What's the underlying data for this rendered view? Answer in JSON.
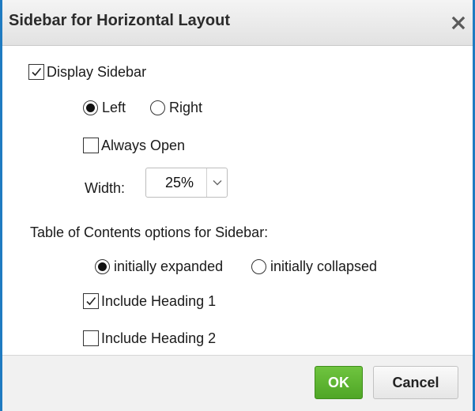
{
  "dialog": {
    "title": "Sidebar for Horizontal Layout",
    "close_icon": "close-icon"
  },
  "options": {
    "display_sidebar": {
      "label": "Display Sidebar",
      "checked": true
    },
    "position": {
      "left_label": "Left",
      "right_label": "Right",
      "selected": "Left"
    },
    "always_open": {
      "label": "Always Open",
      "checked": false
    },
    "width": {
      "label": "Width:",
      "value": "25%"
    },
    "toc_heading": "Table of Contents options for Sidebar:",
    "toc_state": {
      "expanded_label": "initially expanded",
      "collapsed_label": "initially collapsed",
      "selected": "initially expanded"
    },
    "heading1": {
      "label": "Include Heading 1",
      "checked": true
    },
    "heading2": {
      "label": "Include Heading 2",
      "checked": false
    }
  },
  "footer": {
    "ok_label": "OK",
    "cancel_label": "Cancel"
  },
  "colors": {
    "accent_border": "#1f7bc1",
    "ok_green": "#5cb531"
  }
}
